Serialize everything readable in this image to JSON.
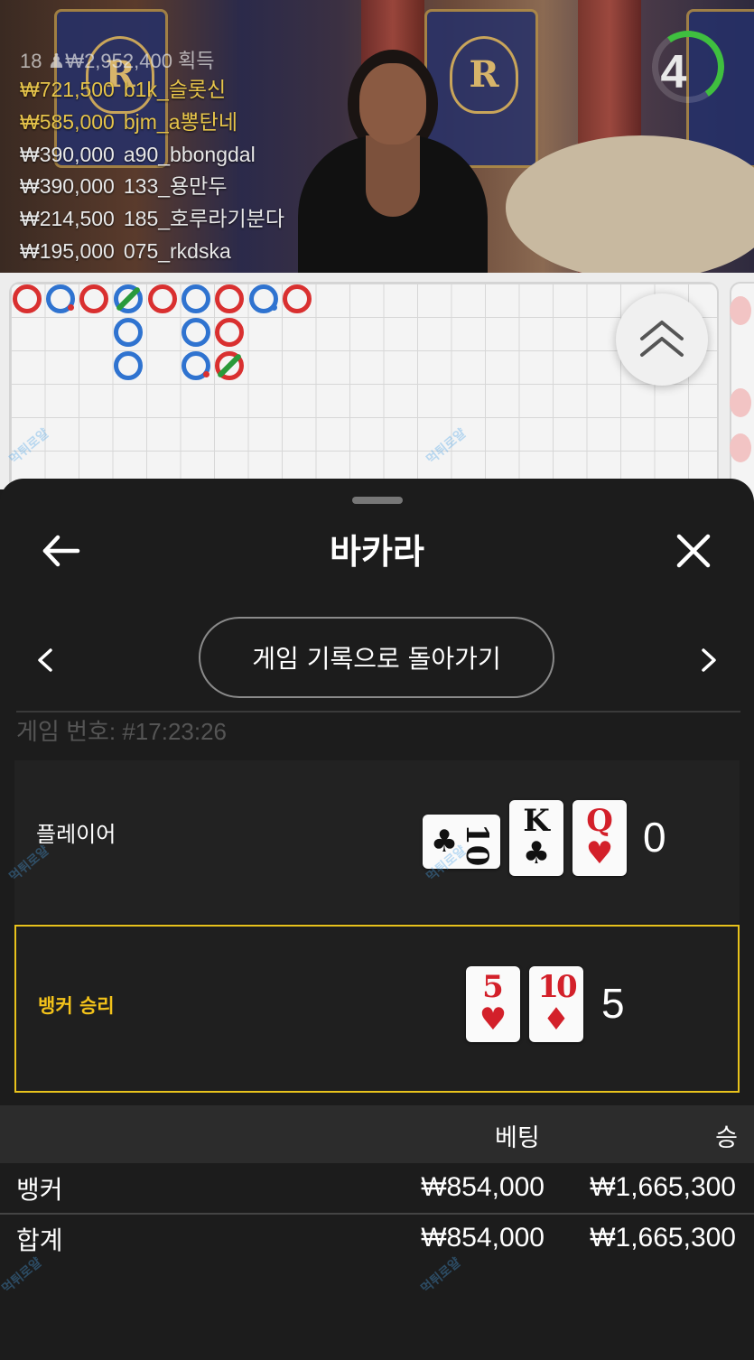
{
  "stream": {
    "timer": "4",
    "winners_header": "18 ♟₩2,952,400 획득",
    "winners": [
      {
        "amount": "₩721,500",
        "name": "b1k_슬롯신",
        "color": "#e6c44a"
      },
      {
        "amount": "₩585,000",
        "name": "bjm_a뽕탄네",
        "color": "#e6c44a"
      },
      {
        "amount": "₩390,000",
        "name": "a90_bbongdal",
        "color": "#e8e8e8"
      },
      {
        "amount": "₩390,000",
        "name": "133_용만두",
        "color": "#e8e8e8"
      },
      {
        "amount": "₩214,500",
        "name": "185_호루라기분다",
        "color": "#e8e8e8"
      },
      {
        "amount": "₩195,000",
        "name": "075_rkdska",
        "color": "#e8e8e8"
      }
    ]
  },
  "scoreboard": {
    "banker_color": "#d93030",
    "player_color": "#2f73d0",
    "tie_color": "#2a9a3a",
    "watermark": "먹튀로얄"
  },
  "sheet": {
    "title": "바카라",
    "history_button": "게임 기록으로 돌아가기",
    "game_number": "게임 번호: #17:23:26",
    "player": {
      "label": "플레이어",
      "total": "0",
      "cards": [
        {
          "rank": "10",
          "suit": "♣",
          "color": "black"
        },
        {
          "rank": "K",
          "suit": "♣",
          "color": "black"
        },
        {
          "rank": "Q",
          "suit": "♥",
          "color": "red"
        }
      ]
    },
    "banker": {
      "label": "뱅커 승리",
      "total": "5",
      "highlight_color": "#e8c21c",
      "cards": [
        {
          "rank": "5",
          "suit": "♥",
          "color": "red"
        },
        {
          "rank": "10",
          "suit": "♦",
          "color": "red"
        }
      ]
    },
    "table": {
      "headers": {
        "bet": "베팅",
        "win": "승"
      },
      "rows": [
        {
          "label": "뱅커",
          "bet": "₩854,000",
          "win": "₩1,665,300"
        },
        {
          "label": "합계",
          "bet": "₩854,000",
          "win": "₩1,665,300"
        }
      ]
    }
  }
}
